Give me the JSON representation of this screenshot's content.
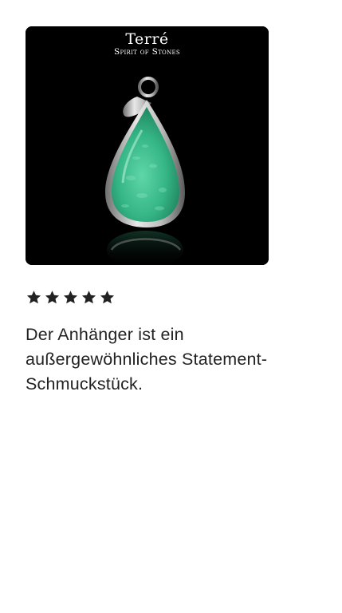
{
  "product_image": {
    "brand_name": "Terré",
    "brand_tagline": "Spirit of Stones",
    "background_color": "#000000",
    "stone_color": "#3fbf8f"
  },
  "review": {
    "rating": 5,
    "max_rating": 5,
    "star_color": "#222222",
    "text": "Der Anhänger ist ein außergewöhnliches Statement-Schmuckstück."
  }
}
